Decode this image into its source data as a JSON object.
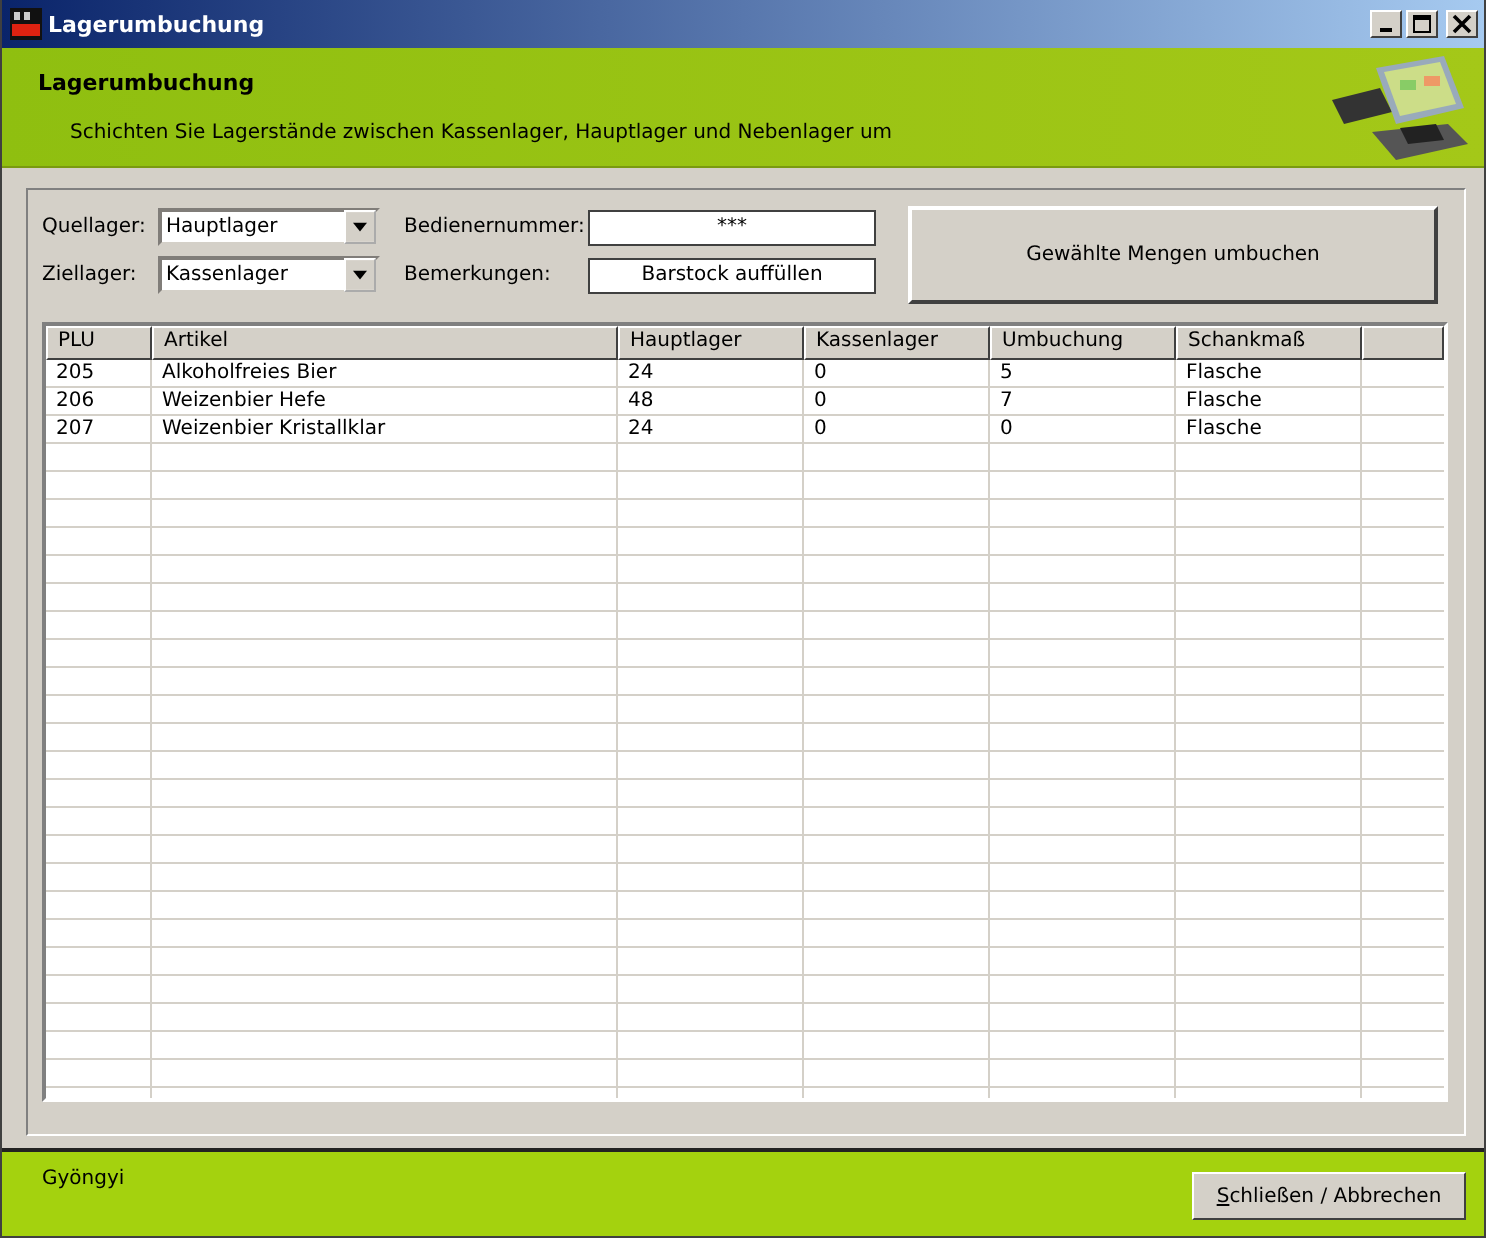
{
  "window": {
    "title": "Lagerumbuchung"
  },
  "header": {
    "title": "Lagerumbuchung",
    "subtitle": "Schichten Sie Lagerstände zwischen Kassenlager, Hauptlager und Nebenlager um"
  },
  "form": {
    "source_label": "Quellager:",
    "source_value": "Hauptlager",
    "target_label": "Ziellager:",
    "target_value": "Kassenlager",
    "operator_label": "Bedienernummer:",
    "operator_value": "***",
    "notes_label": "Bemerkungen:",
    "notes_value": "Barstock auffüllen",
    "submit_button": "Gewählte Mengen umbuchen"
  },
  "table": {
    "columns": [
      "PLU",
      "Artikel",
      "Hauptlager",
      "Kassenlager",
      "Umbuchung",
      "Schankmaß"
    ],
    "rows": [
      [
        "205",
        "Alkoholfreies Bier",
        "24",
        "0",
        "5",
        "Flasche"
      ],
      [
        "206",
        "Weizenbier Hefe",
        "48",
        "0",
        "7",
        "Flasche"
      ],
      [
        "207",
        "Weizenbier Kristallklar",
        "24",
        "0",
        "0",
        "Flasche"
      ]
    ]
  },
  "status_bar": {
    "user": "Gyöngyi",
    "close_button": "Schließen / Abbrechen"
  }
}
